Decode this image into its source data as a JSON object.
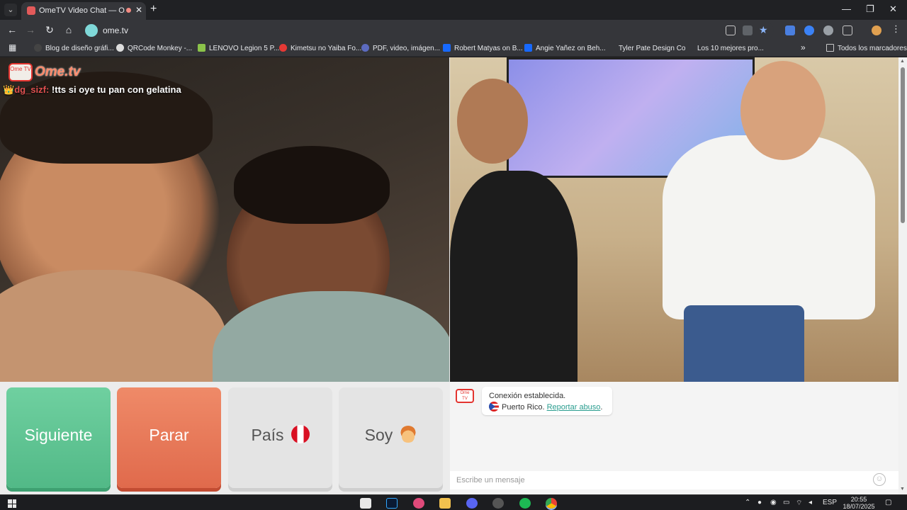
{
  "browser": {
    "tab_title": "OmeTV Video Chat — Ome",
    "url": "ome.tv",
    "bookmarks": [
      "Blog de diseño gráfi...",
      "QRCode Monkey -...",
      "LENOVO Legion 5 P...",
      "Kimetsu no Yaiba Fo...",
      "PDF, video, imágen...",
      "Robert Matyas on B...",
      "Angie Yañez on Beh...",
      "Tyler Pate Design Co",
      "Los 10 mejores pro..."
    ],
    "all_bookmarks": "Todos los marcadores",
    "icons": {
      "tab_search": "chevron-down-icon",
      "back": "arrow-left-icon",
      "forward": "arrow-right-icon",
      "reload": "reload-icon",
      "home": "home-icon"
    }
  },
  "page": {
    "logo_small": "Ome TV",
    "logo_text": "Ome.tv",
    "caption": {
      "crown": "👑",
      "user": "dg_sizf:",
      "text": " !tts si oye tu pan con gelatina"
    },
    "buttons": {
      "next": "Siguiente",
      "stop": "Parar",
      "country": "País",
      "soy": "Soy"
    },
    "chat": {
      "status": "Conexión establecida.",
      "country": "Puerto Rico.",
      "report": "Reportar abuso",
      "report_suffix": ".",
      "input_placeholder": "Escribe un mensaje"
    }
  },
  "taskbar": {
    "language": "ESP",
    "time": "20:55",
    "date": "18/07/2025"
  },
  "colors": {
    "next": "#5ec294",
    "stop": "#e87758",
    "accent_link": "#2a9d8f"
  }
}
